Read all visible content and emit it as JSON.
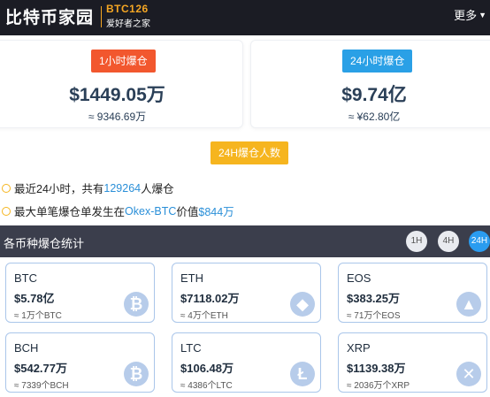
{
  "header": {
    "logo_text": "比特币家园",
    "logo_code": "BTC126",
    "logo_slogan": "爱好者之家",
    "more_label": "更多"
  },
  "summary": [
    {
      "tag": "1小时爆仓",
      "amount": "$1449.05万",
      "cny": "≈ 9346.69万",
      "color": "#f2572e"
    },
    {
      "tag": "24小时爆仓",
      "amount": "$9.74亿",
      "cny": "≈ ¥62.80亿",
      "color": "#2aa0e6"
    }
  ],
  "people": {
    "tag": "24H爆仓人数",
    "line1_prefix": "最近24小时，共有",
    "line1_count": "129264",
    "line1_suffix": "人爆仓",
    "line2_prefix": "最大单笔爆仓单发生在",
    "line2_exchange": "Okex-BTC",
    "line2_mid": "价值",
    "line2_value": "$844万"
  },
  "stats": {
    "title": "各币种爆仓统计",
    "periods": [
      "1H",
      "4H",
      "24H"
    ],
    "active_period": "24H"
  },
  "coins": [
    {
      "name": "BTC",
      "amount": "$5.78亿",
      "qty": "≈ 1万个BTC",
      "icon": "bitcoin-icon",
      "glyph": "₿"
    },
    {
      "name": "ETH",
      "amount": "$7118.02万",
      "qty": "≈ 4万个ETH",
      "icon": "ethereum-icon",
      "glyph": "◆"
    },
    {
      "name": "EOS",
      "amount": "$383.25万",
      "qty": "≈ 71万个EOS",
      "icon": "eos-icon",
      "glyph": "▲"
    },
    {
      "name": "BCH",
      "amount": "$542.77万",
      "qty": "≈ 7339个BCH",
      "icon": "bitcoin-cash-icon",
      "glyph": "₿"
    },
    {
      "name": "LTC",
      "amount": "$106.48万",
      "qty": "≈ 4386个LTC",
      "icon": "litecoin-icon",
      "glyph": "Ł"
    },
    {
      "name": "XRP",
      "amount": "$1139.38万",
      "qty": "≈ 2036万个XRP",
      "icon": "ripple-icon",
      "glyph": "✕"
    }
  ]
}
